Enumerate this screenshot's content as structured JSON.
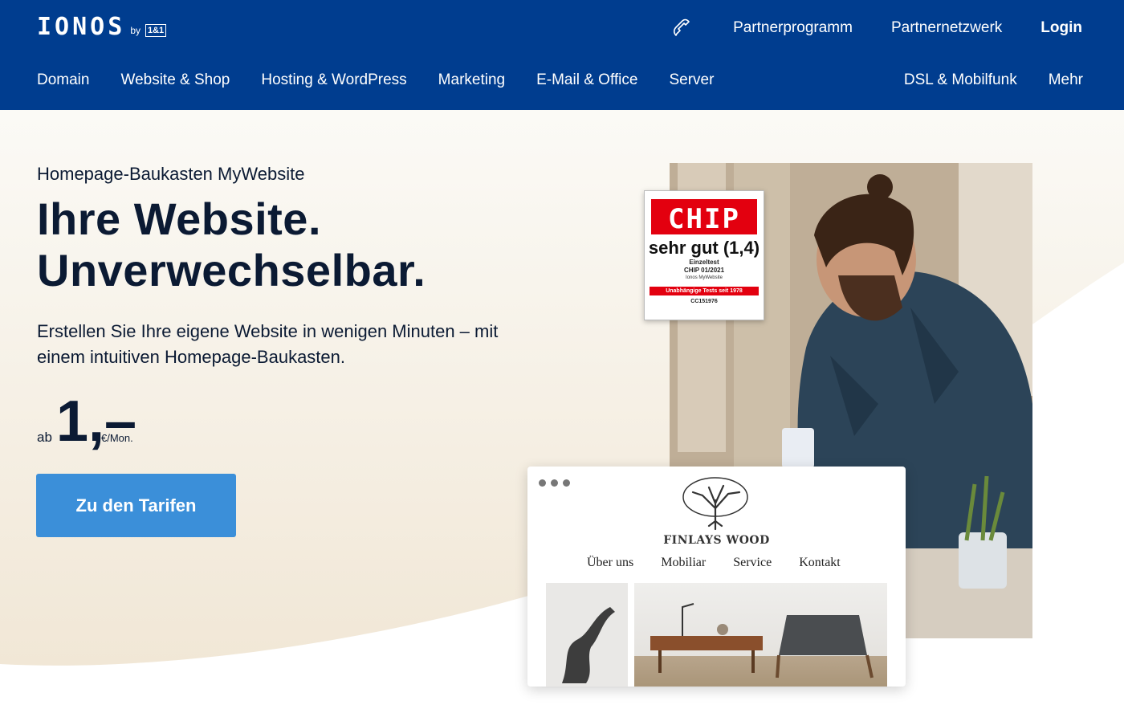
{
  "header": {
    "logo": {
      "word": "IONOS",
      "by": "by",
      "badge": "1&1"
    },
    "top_links": [
      "Partnerprogramm",
      "Partnernetzwerk"
    ],
    "login_label": "Login",
    "main_nav": [
      "Domain",
      "Website & Shop",
      "Hosting & WordPress",
      "Marketing",
      "E-Mail & Office",
      "Server"
    ],
    "right_nav": [
      "DSL & Mobilfunk",
      "Mehr"
    ]
  },
  "hero": {
    "eyebrow": "Homepage-Baukasten MyWebsite",
    "headline_line1": "Ihre Website.",
    "headline_line2": "Unverwechselbar.",
    "subtext": "Erstellen Sie Ihre eigene Website in wenigen Minuten – mit einem intuitiven Homepage-Baukasten.",
    "price_prefix": "ab",
    "price_amount": "1,–",
    "price_unit": "€/Mon.",
    "cta_label": "Zu den Tarifen"
  },
  "chip_badge": {
    "logo": "CHIP",
    "grade": "sehr gut (1,4)",
    "line1": "Einzeltest",
    "line2": "CHIP 01/2021",
    "line3": "Ionos MyWebsite",
    "bar": "Unabhängige Tests seit 1978",
    "code": "CC151976"
  },
  "browser_mock": {
    "brand": "FINLAYS WOOD",
    "nav": [
      "Über uns",
      "Mobiliar",
      "Service",
      "Kontakt"
    ]
  },
  "colors": {
    "header_bg": "#003d8f",
    "cta_bg": "#3b8fd9",
    "hero_bg": "#f6f0e6",
    "chip_red": "#e3000f"
  },
  "icons": {
    "phone": "phone-icon",
    "tree": "tree-logo-icon"
  }
}
